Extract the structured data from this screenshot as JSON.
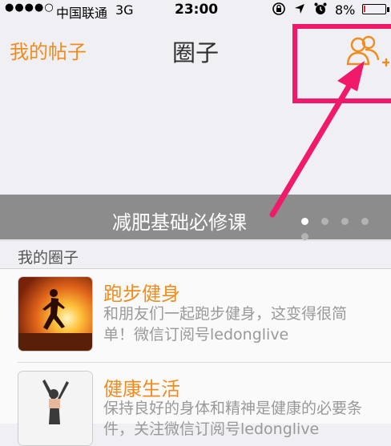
{
  "status_bar": {
    "signal": "●●●●○",
    "carrier": "中国联通",
    "network": "3G",
    "time": "23:00",
    "battery_pct": "8%",
    "icons": [
      "lock-rotation-icon",
      "location-arrow-icon",
      "alarm-icon"
    ],
    "battery_level": 0.08
  },
  "nav": {
    "left_label": "我的帖子",
    "title": "圈子",
    "right_icon": "add-friends-icon"
  },
  "banner": {
    "text": "减肥基础必修课",
    "page_count": 5,
    "active_page": 1
  },
  "section": {
    "label": "我的圈子"
  },
  "circles": [
    {
      "title": "跑步健身",
      "description": "和朋友们一起跑步健身，这变得很简单！微信订阅号ledonglive"
    },
    {
      "title": "健康生活",
      "description": "保持良好的身体和精神是健康的必要条件，关注微信订阅号ledonglive"
    }
  ],
  "colors": {
    "accent": "#f08c1e",
    "annotation": "#f0196a",
    "banner_bg": "#8c8c8c",
    "page_bg": "#efeff4"
  }
}
